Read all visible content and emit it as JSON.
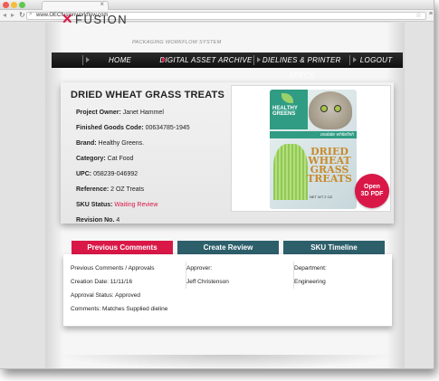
{
  "browser": {
    "url": "www.OECfusionworkflow.com",
    "tab_close": "×"
  },
  "logo": {
    "mark": "✕",
    "name": "FUSION",
    "tagline": "PACKAGING WORKFLOW SYSTEM"
  },
  "nav": {
    "items": [
      {
        "label": "HOME"
      },
      {
        "label": "DIGITAL ASSET ARCHIVE"
      },
      {
        "label": "DIELINES & PRINTER SPECS"
      },
      {
        "label": "LOGOUT"
      }
    ],
    "active_index": 1
  },
  "product": {
    "title": "DRIED WHEAT GRASS TREATS",
    "attributes": [
      {
        "label": "Project Owner:",
        "value": "Janet Hammel"
      },
      {
        "label": "Finished Goods Code:",
        "value": "00634785-1945"
      },
      {
        "label": "Brand:",
        "value": "Healthy Greens."
      },
      {
        "label": "Category:",
        "value": "Cat Food"
      },
      {
        "label": "UPC:",
        "value": "058239-046992"
      },
      {
        "label": "Reference:",
        "value": "2 OZ Treats"
      },
      {
        "label": "SKU Status:",
        "value": "Waiting Review"
      },
      {
        "label": "Revision No.",
        "value": "4"
      }
    ],
    "package": {
      "brand_line1": "HEALTHY",
      "brand_line2": "GREENS",
      "tagline": "oxalate whitefish",
      "big_text": [
        "DRIED",
        "WHEAT",
        "GRASS",
        "TREATS"
      ],
      "weight": "NET WT 2 OZ"
    },
    "open_pdf": [
      "Open",
      "3D PDF"
    ]
  },
  "tabs": [
    {
      "label": "Previous Comments",
      "active": true
    },
    {
      "label": "Create Review",
      "active": false
    },
    {
      "label": "SKU Timeline",
      "active": false
    }
  ],
  "panel": {
    "col1": [
      "Previous Comments / Approvals",
      "Creation Date: 11/11/16",
      "Approval Status: Approved",
      "Comments: Matches Supplied dieline"
    ],
    "col2": [
      "Approver:",
      "Jeff Christenson"
    ],
    "col3": [
      "Department:",
      "Engineering"
    ]
  },
  "colors": {
    "accent": "#d91847",
    "tab_teal": "#2d5f6b",
    "nav_bg": "#1a1a1a"
  }
}
